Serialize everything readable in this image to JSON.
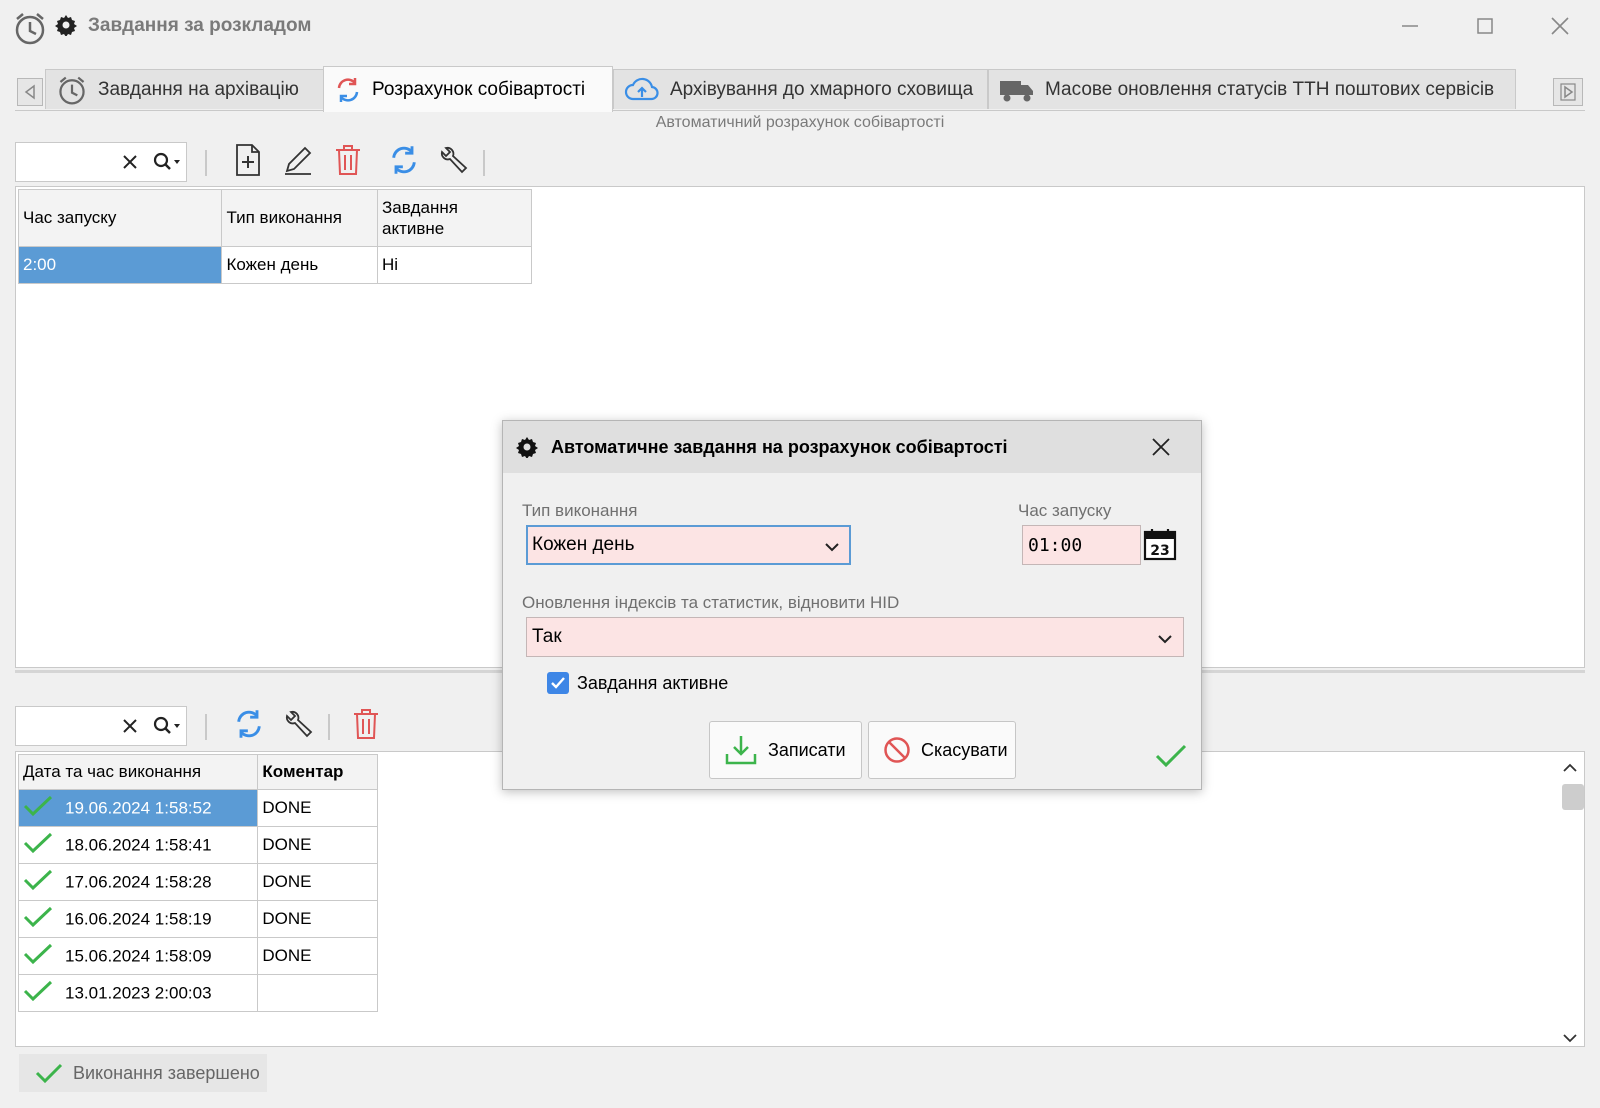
{
  "window": {
    "title": "Завдання за розкладом",
    "app_icon": "alarm-clock-icon",
    "controls": [
      "minimize",
      "maximize",
      "close"
    ]
  },
  "tabs": [
    {
      "label": "Завдання на архівацію",
      "icon": "alarm-clock-icon",
      "active": false
    },
    {
      "label": "Розрахунок собівартості",
      "icon": "refresh-icon",
      "active": true
    },
    {
      "label": "Архівування до хмарного сховища",
      "icon": "cloud-upload-icon",
      "active": false
    },
    {
      "label": "Масове оновлення статусів ТТН поштових сервісів",
      "icon": "truck-icon",
      "active": false
    }
  ],
  "subtitle": "Автоматичний розрахунок собівартості",
  "top_grid": {
    "columns": [
      "Час запуску",
      "Тип виконання",
      "Завдання\nактивне"
    ],
    "rows": [
      {
        "time": "2:00",
        "type": "Кожен день",
        "active": "Ні"
      }
    ]
  },
  "bottom_grid": {
    "columns": [
      "Дата та час виконання",
      "Коментар"
    ],
    "rows": [
      {
        "datetime": "19.06.2024 1:58:52",
        "comment": "DONE"
      },
      {
        "datetime": "18.06.2024 1:58:41",
        "comment": "DONE"
      },
      {
        "datetime": "17.06.2024 1:58:28",
        "comment": "DONE"
      },
      {
        "datetime": "16.06.2024 1:58:19",
        "comment": "DONE"
      },
      {
        "datetime": "15.06.2024 1:58:09",
        "comment": "DONE"
      },
      {
        "datetime": "13.01.2023 2:00:03",
        "comment": ""
      }
    ]
  },
  "status": "Виконання завершено",
  "dialog": {
    "title": "Автоматичне завдання на розрахунок собівартості",
    "type_label": "Тип виконання",
    "type_value": "Кожен день",
    "time_label": "Час запуску",
    "time_value": "01:00",
    "calendar_day": "23",
    "index_label": "Оновлення індексів та статистик, відновити HID",
    "index_value": "Так",
    "active_label": "Завдання активне",
    "active_checked": true,
    "save_label": "Записати",
    "cancel_label": "Скасувати"
  },
  "colors": {
    "selection": "#5b9bd5",
    "required_field": "#fce4e4",
    "success": "#3cb44b",
    "delete": "#e05555",
    "refresh": "#3a8ee6"
  }
}
